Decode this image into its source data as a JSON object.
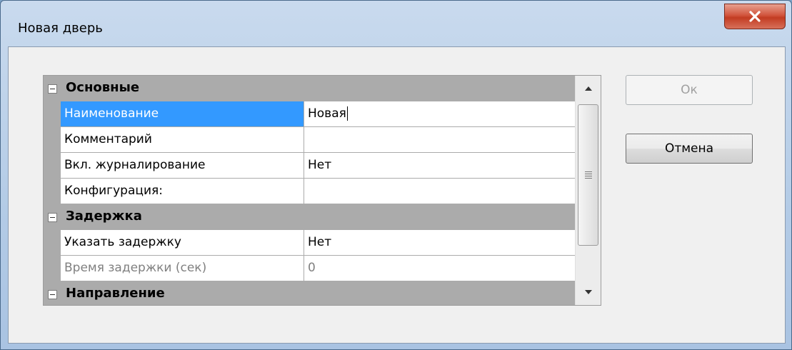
{
  "window": {
    "title": "Новая дверь",
    "close_glyph": "×"
  },
  "grid": {
    "categories": [
      {
        "label": "Основные",
        "properties": [
          {
            "name": "Наименование",
            "value": "Новая",
            "selected": true
          },
          {
            "name": "Комментарий",
            "value": ""
          },
          {
            "name": "Вкл. журналирование",
            "value": "Нет"
          },
          {
            "name": "Конфигурация:",
            "value": ""
          }
        ]
      },
      {
        "label": "Задержка",
        "properties": [
          {
            "name": "Указать задержку",
            "value": "Нет"
          },
          {
            "name": "Время задержки (сек)",
            "value": "0",
            "disabled": true
          }
        ]
      },
      {
        "label": "Направление",
        "properties": []
      }
    ]
  },
  "buttons": {
    "ok_label": "Ок",
    "cancel_label": "Отмена"
  },
  "icons": {
    "close": "close-icon",
    "collapse": "minus-icon",
    "scroll_up": "arrow-up-icon",
    "scroll_down": "arrow-down-icon",
    "grip": "grip-icon"
  },
  "colors": {
    "selection": "#3399ff",
    "category_band": "#ababab",
    "close_button": "#c23c22"
  }
}
